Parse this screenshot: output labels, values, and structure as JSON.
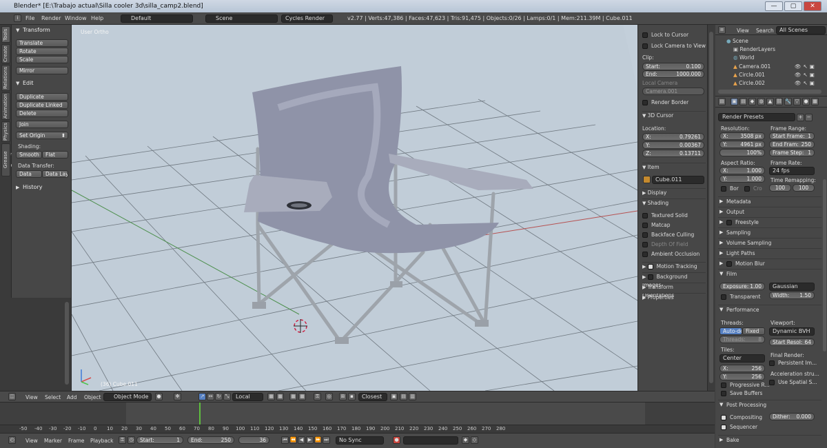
{
  "window": {
    "title": "Blender* [E:\\Trabajo actual\\Silla cooler 3d\\silla_camp2.blend]",
    "min": "—",
    "max": "▢",
    "close": "✕"
  },
  "topbar": {
    "menus": [
      "File",
      "Render",
      "Window",
      "Help"
    ],
    "layout": "Default",
    "scene": "Scene",
    "engine": "Cycles Render",
    "stats": "v2.77 | Verts:47,386 | Faces:47,623 | Tris:91,475 | Objects:0/26 | Lamps:0/1 | Mem:211.39M | Cube.011"
  },
  "vtabs": [
    "Tools",
    "Create",
    "Relations",
    "Animation",
    "Physics",
    "Grease Pencil"
  ],
  "tools": {
    "transform": {
      "title": "Transform",
      "buttons": [
        "Translate",
        "Rotate",
        "Scale",
        "Mirror"
      ]
    },
    "edit": {
      "title": "Edit",
      "buttons": [
        "Duplicate",
        "Duplicate Linked",
        "Delete",
        "Join"
      ],
      "set_origin": "Set Origin"
    },
    "shading": {
      "label": "Shading:",
      "smooth": "Smooth",
      "flat": "Flat"
    },
    "data_transfer": {
      "label": "Data Transfer:",
      "data": "Data",
      "layout": "Data Layo"
    },
    "history": "History"
  },
  "viewport": {
    "view_label": "User Ortho",
    "object_label": "(36) Cube.011"
  },
  "npanel": {
    "lock_cursor": "Lock to Cursor",
    "lock_camera": "Lock Camera to View",
    "clip": "Clip:",
    "clip_start": {
      "k": "Start:",
      "v": "0.100"
    },
    "clip_end": {
      "k": "End:",
      "v": "1000.000"
    },
    "local_camera": "Local Camera",
    "camera": "Camera.001",
    "render_border": "Render Border",
    "cursor_title": "3D Cursor",
    "location": "Location:",
    "cx": {
      "k": "X:",
      "v": "0.79261"
    },
    "cy": {
      "k": "Y:",
      "v": "0.00367"
    },
    "cz": {
      "k": "Z:",
      "v": "0.13711"
    },
    "item_title": "Item",
    "item_name": "Cube.011",
    "display": "Display",
    "shading": "Shading",
    "textured_solid": "Textured Solid",
    "matcap": "Matcap",
    "backface": "Backface Culling",
    "dof": "Depth Of Field",
    "ao": "Ambient Occlusion",
    "motion": "Motion Tracking",
    "bg_images": "Background Images",
    "transform_orient": "Transform Orientations",
    "properties": "Properties"
  },
  "outliner": {
    "view": "View",
    "search": "Search",
    "filter": "All Scenes",
    "items": [
      "Scene",
      "RenderLayers",
      "World",
      "Camera.001",
      "Circle.001",
      "Circle.002"
    ]
  },
  "props": {
    "presets": "Render Presets",
    "resolution": "Resolution:",
    "res_x": {
      "k": "X:",
      "v": "3508 px"
    },
    "res_y": {
      "k": "Y:",
      "v": "4961 px"
    },
    "res_pct": "100%",
    "frame_range": "Frame Range:",
    "start_frame": {
      "k": "Start Frame:",
      "v": "1"
    },
    "end_frame": {
      "k": "End Fram:",
      "v": "250"
    },
    "frame_step": {
      "k": "Frame Step:",
      "v": "1"
    },
    "aspect": "Aspect Ratio:",
    "asp_x": {
      "k": "X:",
      "v": "1.000"
    },
    "asp_y": {
      "k": "Y:",
      "v": "1.000"
    },
    "frame_rate": "Frame Rate:",
    "fps": "24 fps",
    "time_remap": "Time Remapping:",
    "remap_a": "100",
    "remap_b": "100",
    "bor": "Bor",
    "cro": "Cro",
    "sections": [
      "Metadata",
      "Output",
      "Freestyle",
      "Sampling",
      "Volume Sampling",
      "Light Paths",
      "Motion Blur",
      "Film"
    ],
    "exposure": {
      "k": "Exposure:",
      "v": "1.00"
    },
    "filter": "Gaussian",
    "transparent": "Transparent",
    "width": {
      "k": "Width:",
      "v": "1.50"
    },
    "performance": "Performance",
    "threads": "Threads:",
    "auto_detect": "Auto-dete",
    "fixed": "Fixed",
    "threads_val": {
      "k": "Threads:",
      "v": "8"
    },
    "viewport": "Viewport:",
    "bvh": "Dynamic BVH",
    "start_resol": {
      "k": "Start Resol:",
      "v": "64"
    },
    "tiles": "Tiles:",
    "center": "Center",
    "tile_x": {
      "k": "X:",
      "v": "256"
    },
    "tile_y": {
      "k": "Y:",
      "v": "256"
    },
    "final_render": "Final Render:",
    "persistent": "Persistent Im...",
    "accel": "Acceleration stru...",
    "spatial": "Use Spatial S...",
    "progressive": "Progressive R...",
    "save_buffers": "Save Buffers",
    "post": "Post Processing",
    "compositing": "Compositing",
    "sequencer": "Sequencer",
    "dither": {
      "k": "Dither:",
      "v": "0.000"
    },
    "bake": "Bake"
  },
  "vheader": {
    "view": "View",
    "select": "Select",
    "add": "Add",
    "object": "Object",
    "mode": "Object Mode",
    "pivot": "Local",
    "snap": "Closest"
  },
  "timeline": {
    "ticks": [
      "-50",
      "-40",
      "-30",
      "-20",
      "-10",
      "0",
      "10",
      "20",
      "30",
      "40",
      "50",
      "60",
      "70",
      "80",
      "90",
      "100",
      "110",
      "120",
      "130",
      "140",
      "150",
      "160",
      "170",
      "180",
      "190",
      "200",
      "210",
      "220",
      "230",
      "240",
      "250",
      "260",
      "270",
      "280"
    ],
    "view": "View",
    "marker": "Marker",
    "frame": "Frame",
    "playback": "Playback",
    "start": {
      "k": "Start:",
      "v": "1"
    },
    "end": {
      "k": "End:",
      "v": "250"
    },
    "current": "36",
    "sync": "No Sync"
  }
}
